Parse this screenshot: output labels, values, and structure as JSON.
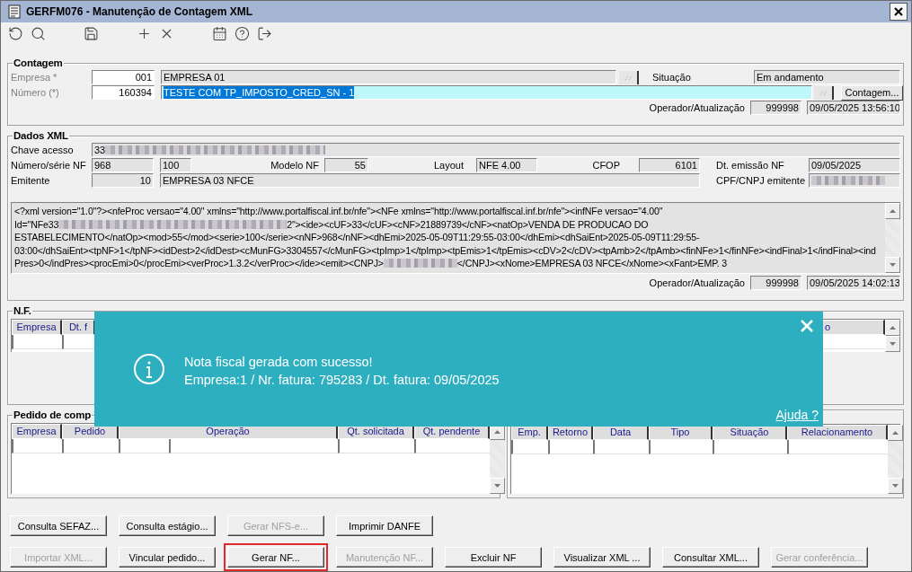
{
  "window": {
    "title": "GERFM076 - Manutenção de Contagem XML"
  },
  "contagem": {
    "title": "Contagem",
    "empresa": {
      "label": "Empresa *",
      "code": "001",
      "name": "EMPRESA 01"
    },
    "numero": {
      "label": "Número (*)",
      "code": "160394",
      "description": "TESTE COM TP_IMPOSTO_CRED_SN - 1",
      "selected": true
    },
    "situacao": {
      "label": "Situação",
      "value": "Em andamento"
    },
    "contagem_button": "Contagem...",
    "operador": {
      "label": "Operador/Atualização",
      "code": "999998",
      "datetime": "09/05/2025 13:56:10"
    }
  },
  "dados_xml": {
    "title": "Dados XML",
    "chave": {
      "label": "Chave acesso",
      "value": "33",
      "redacted": true
    },
    "numero_serie": {
      "label": "Número/série NF",
      "numero": "968",
      "serie": "100"
    },
    "modelo": {
      "label": "Modelo NF",
      "value": "55"
    },
    "layout": {
      "label": "Layout",
      "value": "NFE 4.00"
    },
    "cfop": {
      "label": "CFOP",
      "value": "6101"
    },
    "dt_emissao": {
      "label": "Dt. emissão NF",
      "value": "09/05/2025"
    },
    "emitente": {
      "label": "Emitente",
      "code": "10",
      "name": "EMPRESA 03 NFCE"
    },
    "cpf_cnpj": {
      "label": "CPF/CNPJ emitente",
      "redacted": true
    },
    "xml_lines": [
      {
        "parts": [
          {
            "kind": "text",
            "text": "<?xml version=\"1.0\"?><nfeProc versao=\"4.00\" xmlns=\"http://www.portalfiscal.inf.br/nfe\"><NFe xmlns=\"http://www.portalfiscal.inf.br/nfe\"><infNFe versao=\"4.00\""
          }
        ]
      },
      {
        "parts": [
          {
            "kind": "text",
            "text": "Id=\"NFe33"
          },
          {
            "kind": "redacted"
          },
          {
            "kind": "text",
            "text": "2\"><ide><cUF>33</cUF><cNF>21889739</cNF><natOp>VENDA DE PRODUCAO DO"
          }
        ]
      },
      {
        "parts": [
          {
            "kind": "text",
            "text": "ESTABELECIMENTO</natOp><mod>55</mod><serie>100</serie><nNF>968</nNF><dhEmi>2025-05-09T11:29:55-03:00</dhEmi><dhSaiEnt>2025-05-09T11:29:55-"
          }
        ]
      },
      {
        "parts": [
          {
            "kind": "text",
            "text": "03:00</dhSaiEnt><tpNF>1</tpNF><idDest>2</idDest><cMunFG>3304557</cMunFG><tpImp>1</tpImp><tpEmis>1</tpEmis><cDV>2</cDV><tpAmb>2</tpAmb><finNFe>1</finNFe><indFinal>1</indFinal><ind"
          }
        ]
      },
      {
        "parts": [
          {
            "kind": "text",
            "text": "Pres>0</indPres><procEmi>0</procEmi><verProc>1.3.2</verProc></ide><emit><CNPJ>"
          },
          {
            "kind": "redacted"
          },
          {
            "kind": "text",
            "text": "</CNPJ><xNome>EMPRESA 03 NFCE</xNome><xFant>EMP. 3"
          }
        ]
      }
    ],
    "operador": {
      "label": "Operador/Atualização",
      "code": "999998",
      "datetime": "09/05/2025 14:02:13"
    }
  },
  "nf": {
    "title": "N.F.",
    "columns": [
      "Empresa",
      "Dt. f",
      "o"
    ]
  },
  "pedido": {
    "title": "Pedido de comp",
    "columns": [
      "Empresa",
      "Pedido",
      "Operação",
      "Qt. solicitada",
      "Qt. pendente"
    ]
  },
  "retorno": {
    "columns": [
      "Emp.",
      "Retorno",
      "Data",
      "Tipo",
      "Situação",
      "Relacionamento"
    ]
  },
  "toast": {
    "message": "Nota fiscal gerada com sucesso!",
    "detail": "Empresa:1 / Nr. fatura: 795283 / Dt. fatura: 09/05/2025",
    "help_link": "Ajuda ?"
  },
  "button_rows": [
    [
      {
        "label": "Consulta SEFAZ...",
        "disabled": false,
        "highlighted": false
      },
      {
        "label": "Consulta estágio...",
        "disabled": false,
        "highlighted": false
      },
      {
        "label": "Gerar NFS-e...",
        "disabled": true,
        "highlighted": false
      },
      {
        "label": "Imprimir DANFE",
        "disabled": false,
        "highlighted": false
      }
    ],
    [
      {
        "label": "Importar XML...",
        "disabled": true,
        "highlighted": false
      },
      {
        "label": "Vincular pedido...",
        "disabled": false,
        "highlighted": false
      },
      {
        "label": "Gerar NF...",
        "disabled": false,
        "highlighted": true
      },
      {
        "label": "Manutenção NF...",
        "disabled": true,
        "highlighted": false
      },
      {
        "label": "Excluir NF",
        "disabled": false,
        "highlighted": false
      },
      {
        "label": "Visualizar XML ...",
        "disabled": false,
        "highlighted": false
      },
      {
        "label": "Consultar XML...",
        "disabled": false,
        "highlighted": false
      },
      {
        "label": "Gerar conferência...",
        "disabled": true,
        "highlighted": false
      }
    ]
  ]
}
